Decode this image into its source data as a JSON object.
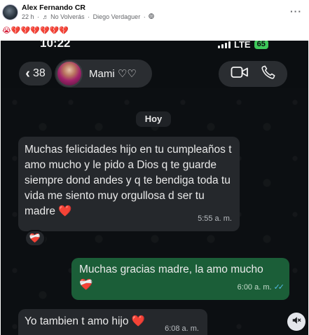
{
  "post": {
    "author": "Alex Fernando CR",
    "age": "22 h",
    "music_note": "♬",
    "song": "No Volverás",
    "separator": "·",
    "artist": "Diego Verdaguer",
    "privacy_icon": "globe-icon",
    "more": "···",
    "caption": "😭💔💔💔💔💔💔"
  },
  "phone": {
    "time": "10:22",
    "network": "LTE",
    "battery": "65"
  },
  "chat": {
    "back_count": "38",
    "contact_name": "Mami ♡♡",
    "day_label": "Hoy",
    "messages": [
      {
        "direction": "incoming",
        "text": "Muchas felicidades hijo en tu cumpleaños t amo mucho y le pido a Dios q te guarde siempre dond andes y q te bendiga toda tu vida me siento muy orgullosa d ser tu madre",
        "emoji": "❤️",
        "time": "5:55 a. m.",
        "reaction": "❤️‍🩹"
      },
      {
        "direction": "outgoing",
        "text": "Muchas gracias madre, la amo mucho",
        "emoji": "❤️‍🩹",
        "time": "6:00 a. m.",
        "status": "✓✓"
      },
      {
        "direction": "incoming",
        "text": "Yo tambien t amo hijo",
        "emoji": "❤️",
        "time": "6:08 a. m."
      }
    ]
  },
  "colors": {
    "incoming_bubble": "#25282c",
    "outgoing_bubble": "#1b5e38",
    "read_ticks": "#53bdeb",
    "background": "#0c0f12"
  }
}
